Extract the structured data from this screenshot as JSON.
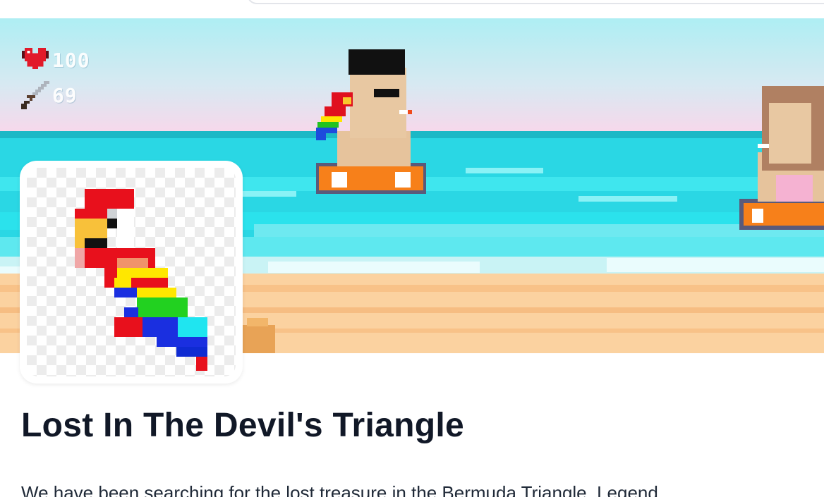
{
  "hud": {
    "health": {
      "icon": "heart-icon",
      "value": "100"
    },
    "attack": {
      "icon": "sword-icon",
      "value": "69"
    }
  },
  "banner": {
    "scene": "pixel-beach-scene"
  },
  "avatar": {
    "icon": "parrot-icon"
  },
  "title": "Lost In The Devil's Triangle",
  "description": "We have been searching for the lost treasure in the Bermuda Triangle. Legend"
}
